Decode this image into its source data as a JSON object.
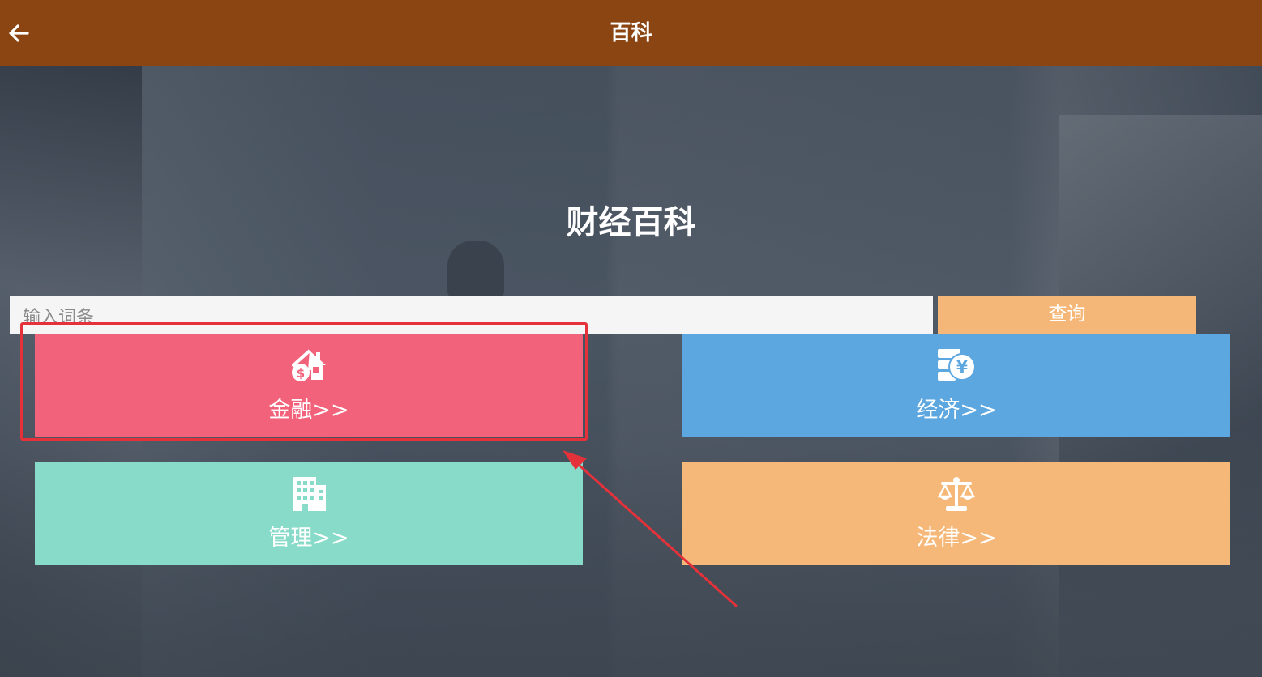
{
  "header": {
    "title": "百科",
    "back_icon": "arrow-left-icon"
  },
  "hero": {
    "title": "财经百科"
  },
  "search": {
    "placeholder": "输入词条",
    "value": "",
    "button_label": "查询"
  },
  "categories": [
    {
      "label": "金融>>",
      "icon": "house-dollar-icon",
      "color": "#f2627a"
    },
    {
      "label": "经济>>",
      "icon": "yuan-coins-icon",
      "color": "#5ca7e0"
    },
    {
      "label": "管理>>",
      "icon": "building-icon",
      "color": "#88dbc8"
    },
    {
      "label": "法律>>",
      "icon": "scale-icon",
      "color": "#f6b878"
    }
  ],
  "colors": {
    "header_bg": "#8b4513",
    "search_button": "#f5b778",
    "annotation": "#e5323a"
  }
}
